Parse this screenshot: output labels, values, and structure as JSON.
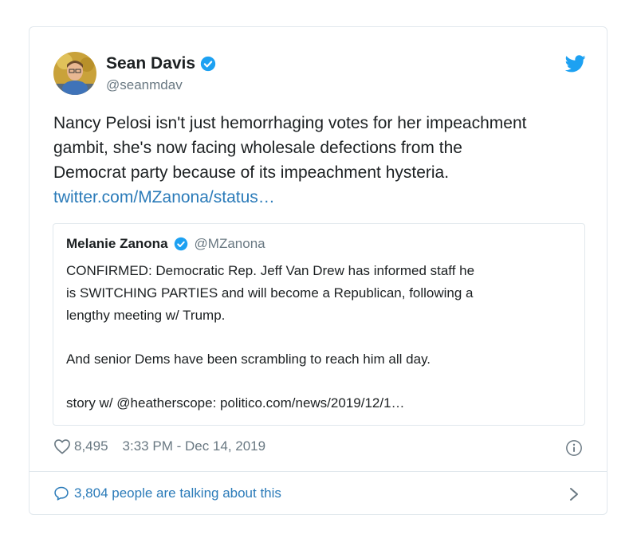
{
  "author": {
    "name": "Sean Davis",
    "handle": "@seanmdav"
  },
  "tweet": {
    "text_lines": [
      "Nancy Pelosi isn't just hemorrhaging votes for her impeachment",
      "gambit, she's now facing wholesale defections from the",
      "Democrat party because of its impeachment hysteria."
    ],
    "link": "twitter.com/MZanona/status…"
  },
  "quoted": {
    "name": "Melanie Zanona",
    "handle": "@MZanona",
    "lines_p1": [
      "CONFIRMED: Democratic Rep. Jeff Van Drew has informed staff he",
      "is SWITCHING PARTIES and will become a Republican, following a",
      "lengthy meeting w/ Trump."
    ],
    "p2": "And senior Dems have been scrambling to reach him all day.",
    "p3": "story w/ @heatherscope: politico.com/news/2019/12/1…"
  },
  "meta": {
    "likes": "8,495",
    "timestamp": "3:33 PM - Dec 14, 2019"
  },
  "footer": {
    "talking": "3,804 people are talking about this"
  },
  "colors": {
    "link": "#2b7bb9",
    "verified": "#1da1f2",
    "muted": "#697882",
    "border": "#e1e8ed"
  },
  "icons": [
    "verified-badge-icon",
    "twitter-bird-icon",
    "heart-icon",
    "info-icon",
    "speech-bubble-icon",
    "chevron-right-icon"
  ]
}
